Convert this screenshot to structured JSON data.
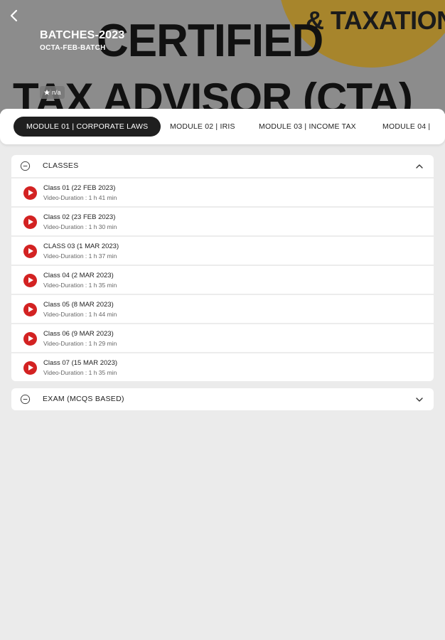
{
  "hero": {
    "batch_title": "BATCHES-2023",
    "batch_subtitle": "OCTA-FEB-BATCH",
    "rating": "n/a",
    "banner_text_1": "& TAXATION",
    "banner_text_2": "CERTIFIED",
    "banner_text_3": "TAX ADVISOR (CTA)",
    "colors": {
      "banner_bg": "#8c8c8c",
      "banner_accent": "#a7852c"
    }
  },
  "tabs": [
    {
      "label": "MODULE 01 | CORPORATE LAWS",
      "active": true
    },
    {
      "label": "MODULE 02 | IRIS",
      "active": false
    },
    {
      "label": "MODULE 03 | INCOME TAX",
      "active": false
    },
    {
      "label": "MODULE 04 |",
      "active": false
    }
  ],
  "sections": [
    {
      "title": "CLASSES",
      "expanded": true,
      "items": [
        {
          "name": "Class 01 (22 FEB 2023)",
          "duration": "Video-Duration : 1 h 41 min"
        },
        {
          "name": "Class 02 (23 FEB 2023)",
          "duration": "Video-Duration : 1 h 30 min"
        },
        {
          "name": "CLASS 03 (1 MAR 2023)",
          "duration": "Video-Duration : 1 h 37 min"
        },
        {
          "name": "Class 04 (2 MAR 2023)",
          "duration": "Video-Duration : 1 h 35 min"
        },
        {
          "name": "Class 05 (8 MAR 2023)",
          "duration": "Video-Duration : 1 h 44 min"
        },
        {
          "name": "Class 06 (9 MAR 2023)",
          "duration": "Video-Duration : 1 h 29 min"
        },
        {
          "name": "Class 07 (15 MAR 2023)",
          "duration": "Video-Duration : 1 h 35 min"
        }
      ]
    },
    {
      "title": "EXAM (MCQS BASED)",
      "expanded": false,
      "items": []
    }
  ],
  "colors": {
    "play_button": "#d32222",
    "active_tab": "#1f1f1f",
    "page_bg": "#ebebeb"
  }
}
